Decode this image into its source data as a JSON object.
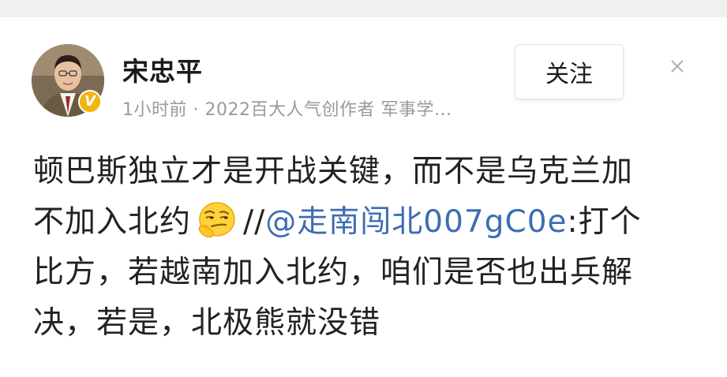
{
  "author": {
    "name": "宋忠平",
    "avatar_icon": "avatar-photo",
    "verified_icon": "verified-v-badge",
    "verified_mark": "V",
    "verified_color": "#f2b411",
    "meta": "1小时前 · 2022百大人气创作者 军事学..."
  },
  "actions": {
    "follow_label": "关注",
    "close_icon": "close-icon"
  },
  "post": {
    "line1": "顿巴斯独立才是开战关键，而不是乌克兰加",
    "line2_prefix": "不加入北约",
    "emoji_name": "thinking-smirk-emoji",
    "line2_slashes": "//",
    "mention": "@走南闯北007gC0e",
    "line2_suffix": ":打个",
    "line3": "比方，若越南加入北约，咱们是否也出兵解",
    "line4": "决，若是，北极熊就没错",
    "mention_color": "#3d6db3"
  }
}
